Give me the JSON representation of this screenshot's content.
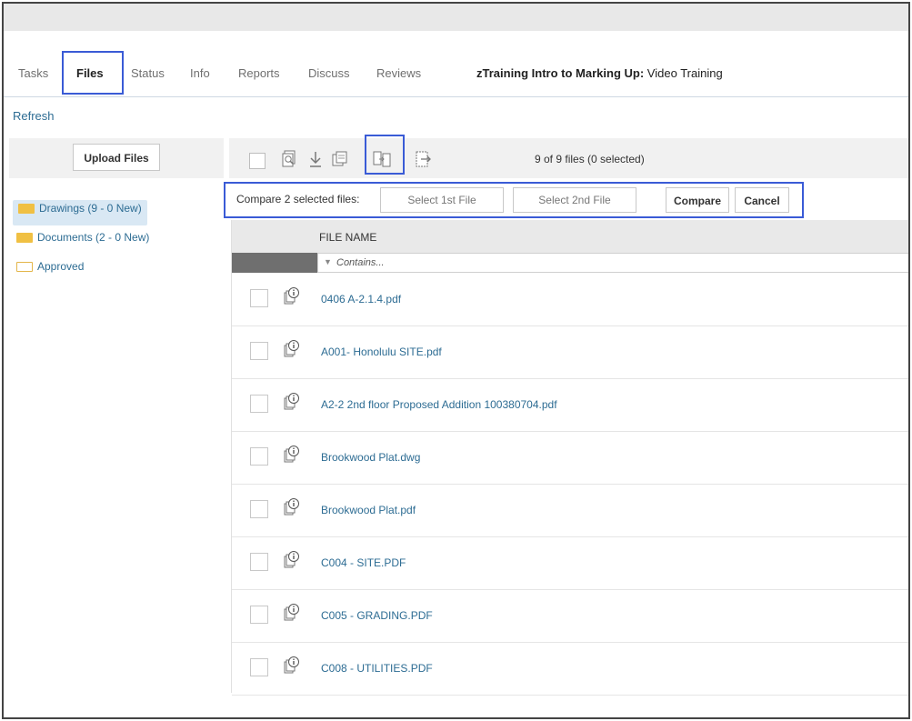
{
  "tabs": [
    "Tasks",
    "Files",
    "Status",
    "Info",
    "Reports",
    "Discuss",
    "Reviews"
  ],
  "project": {
    "name": "zTraining Intro to Marking Up:",
    "subtitle": "Video Training"
  },
  "refresh_label": "Refresh",
  "upload_label": "Upload Files",
  "folders": [
    "Drawings (9 - 0 New)",
    "Documents (2 - 0 New)",
    "Approved"
  ],
  "file_count": "9 of 9 files (0 selected)",
  "compare": {
    "label": "Compare 2 selected files:",
    "select1": "Select 1st File",
    "select2": "Select 2nd File",
    "compare_btn": "Compare",
    "cancel_btn": "Cancel"
  },
  "grid": {
    "column_header": "FILE NAME",
    "filter_placeholder": "Contains...",
    "files": [
      "0406 A-2.1.4.pdf",
      "A001- Honolulu SITE.pdf",
      "A2-2 2nd floor Proposed Addition 100380704.pdf",
      "Brookwood Plat.dwg",
      "Brookwood Plat.pdf",
      "C004 - SITE.PDF",
      "C005 - GRADING.PDF",
      "C008 - UTILITIES.PDF"
    ]
  },
  "colors": {
    "link": "#2d6c93",
    "highlight": "#3a5bd6",
    "folder": "#f0c043"
  }
}
